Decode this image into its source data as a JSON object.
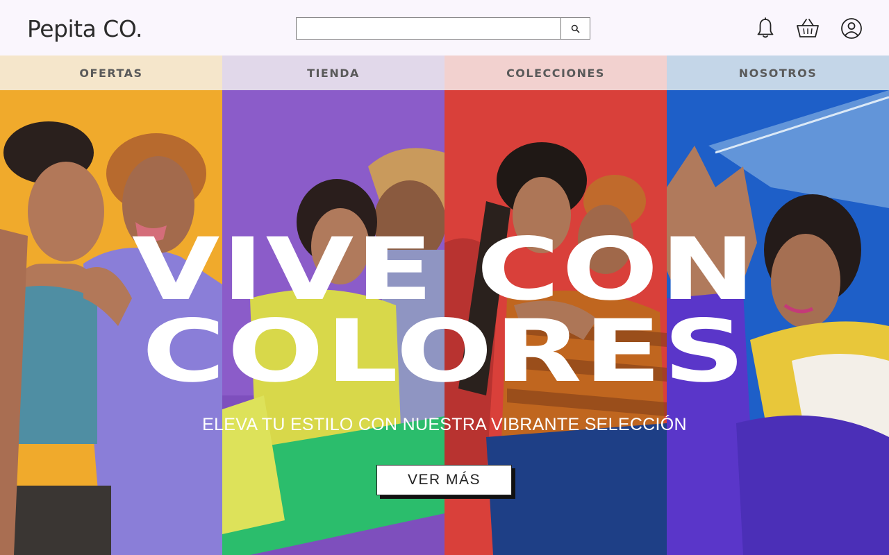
{
  "brand": {
    "logo_text": "Pepita CO."
  },
  "search": {
    "placeholder": "",
    "value": "",
    "icon": "search-icon"
  },
  "header_icons": [
    {
      "name": "notifications",
      "icon": "bell-icon"
    },
    {
      "name": "cart",
      "icon": "basket-icon"
    },
    {
      "name": "account",
      "icon": "user-circle-icon"
    }
  ],
  "nav": {
    "items": [
      {
        "label": "OFERTAS",
        "color": "#f5e6cb"
      },
      {
        "label": "TIENDA",
        "color": "#e1d8ea"
      },
      {
        "label": "COLECCIONES",
        "color": "#f2d1cf"
      },
      {
        "label": "NOSOTROS",
        "color": "#c4d6e8"
      }
    ]
  },
  "hero": {
    "headline_line1": "VIVE CON",
    "headline_line2": "COLORES",
    "tagline": "ELEVA TU ESTILO CON NUESTRA VIBRANTE SELECCIÓN",
    "cta_label": "VER MÁS",
    "panels": [
      {
        "name": "yellow-panel",
        "background": "#f0aa2c"
      },
      {
        "name": "purple-panel",
        "background": "#8b5cc9"
      },
      {
        "name": "red-panel",
        "background": "#d9403a"
      },
      {
        "name": "blue-panel",
        "background": "#1e5fc8"
      }
    ]
  }
}
